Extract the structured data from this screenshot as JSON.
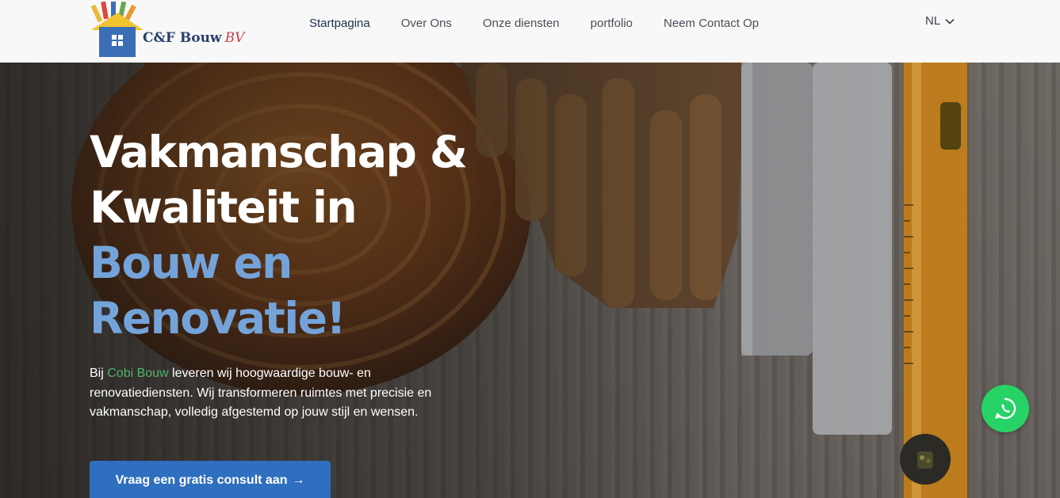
{
  "header": {
    "logo": {
      "name": "C&F Bouw",
      "suffix": "BV"
    },
    "nav": [
      {
        "label": "Startpagina",
        "active": true
      },
      {
        "label": "Over Ons",
        "active": false
      },
      {
        "label": "Onze diensten",
        "active": false
      },
      {
        "label": "portfolio",
        "active": false
      },
      {
        "label": "Neem Contact Op",
        "active": false
      }
    ],
    "language": "NL"
  },
  "hero": {
    "title_lines": [
      "Vakmanschap &",
      "Kwaliteit in"
    ],
    "title_accent_lines": [
      "Bouw en",
      "Renovatie!"
    ],
    "description": {
      "prefix": "Bij ",
      "brand": "Cobi Bouw",
      "suffix": " leveren wij hoogwaardige bouw- en renovatiediensten. Wij transformeren ruimtes met precisie en vakmanschap, volledig afgestemd op jouw stijl en wensen."
    },
    "cta_label": "Vraag een gratis consult aan",
    "cta_arrow": "→"
  },
  "colors": {
    "accent_blue": "#74a3d9",
    "button_blue": "#2f6fbf",
    "brand_green": "#4fb36a",
    "whatsapp_green": "#27d366",
    "logo_red": "#c44545",
    "logo_navy": "#27406b"
  },
  "icons": {
    "whatsapp": "whatsapp-icon",
    "chevron": "chevron-down-icon",
    "logo": "house-tools-logo-icon"
  }
}
